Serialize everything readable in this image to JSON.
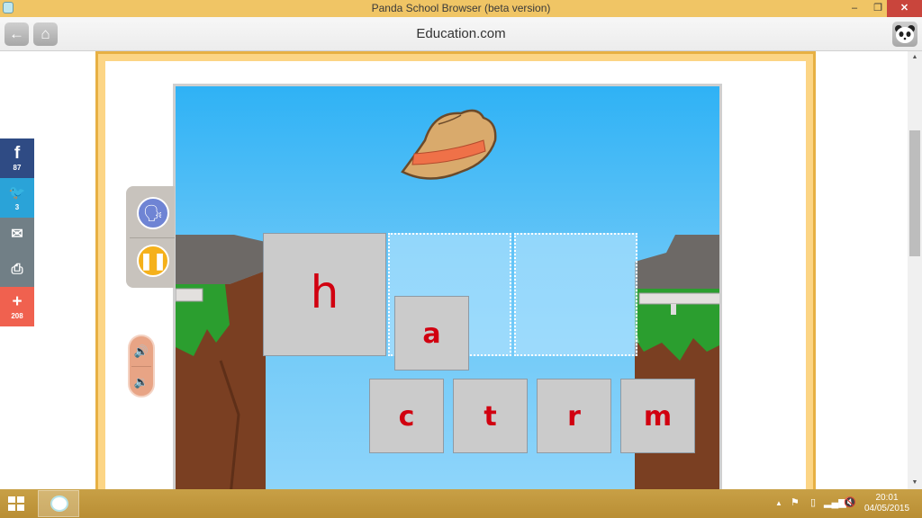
{
  "window": {
    "title": "Panda School Browser (beta version)",
    "minimize": "–",
    "restore": "❐",
    "close": "✕"
  },
  "toolbar": {
    "back_icon": "←",
    "home_icon": "⌂",
    "url": "Education.com",
    "panda_icon": "🐼"
  },
  "share": {
    "facebook": {
      "icon": "f",
      "count": "87"
    },
    "twitter": {
      "icon": "🐦",
      "count": "3"
    },
    "email": {
      "icon": "✉"
    },
    "print": {
      "icon": "⎙"
    },
    "more": {
      "icon": "+",
      "count": "208"
    }
  },
  "game": {
    "controls": {
      "speak_icon": "🗣",
      "pause_icon": "❚❚",
      "volume_up_icon": "🔊",
      "volume_down_icon": "🔉"
    },
    "picture": "hat",
    "placed_letter": "h",
    "empty_slots": 2,
    "dragging_letter": "a",
    "letter_choices": [
      "c",
      "t",
      "r",
      "m"
    ]
  },
  "scrollbar": {
    "up": "▲",
    "down": "▼",
    "position": 0.18
  },
  "taskbar": {
    "tray": {
      "show_hidden": "▲",
      "time": "20:01",
      "date": "04/05/2015"
    }
  }
}
